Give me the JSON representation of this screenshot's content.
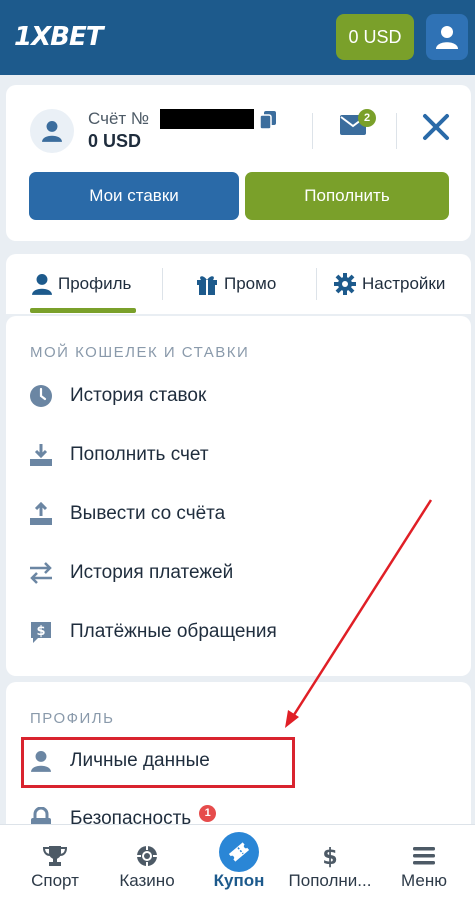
{
  "header": {
    "logo_prefix": "1X",
    "logo_suffix": "BET",
    "balance_label": "0 USD"
  },
  "account": {
    "number_label": "Счёт №",
    "balance": "0 USD",
    "messages_count": "2",
    "my_bets_label": "Мои ставки",
    "topup_label": "Пополнить"
  },
  "tabs": [
    {
      "label": "Профиль",
      "icon": "user-icon",
      "active": true
    },
    {
      "label": "Промо",
      "icon": "gift-icon",
      "active": false
    },
    {
      "label": "Настройки",
      "icon": "gear-icon",
      "active": false
    }
  ],
  "wallet_section": {
    "title": "МОЙ КОШЕЛЕК И СТАВКИ",
    "items": [
      {
        "label": "История ставок",
        "icon": "clock-icon"
      },
      {
        "label": "Пополнить счет",
        "icon": "download-icon"
      },
      {
        "label": "Вывести со счёта",
        "icon": "upload-icon"
      },
      {
        "label": "История платежей",
        "icon": "transfer-arrows-icon"
      },
      {
        "label": "Платёжные обращения",
        "icon": "dollar-chat-icon"
      }
    ]
  },
  "profile_section": {
    "title": "ПРОФИЛЬ",
    "items": [
      {
        "label": "Личные данные",
        "icon": "user-icon"
      },
      {
        "label": "Безопасность",
        "icon": "lock-icon",
        "badge": "1"
      }
    ]
  },
  "bottom_nav": [
    {
      "label": "Спорт",
      "icon": "trophy-icon"
    },
    {
      "label": "Казино",
      "icon": "chip-icon"
    },
    {
      "label": "Купон",
      "icon": "ticket-icon"
    },
    {
      "label": "Пополни...",
      "icon": "dollar-icon"
    },
    {
      "label": "Меню",
      "icon": "menu-icon"
    }
  ],
  "colors": {
    "header_bg": "#1d5a8c",
    "accent_green": "#7aa02a",
    "accent_blue": "#2a6aa8",
    "highlight_red": "#d9232e"
  }
}
